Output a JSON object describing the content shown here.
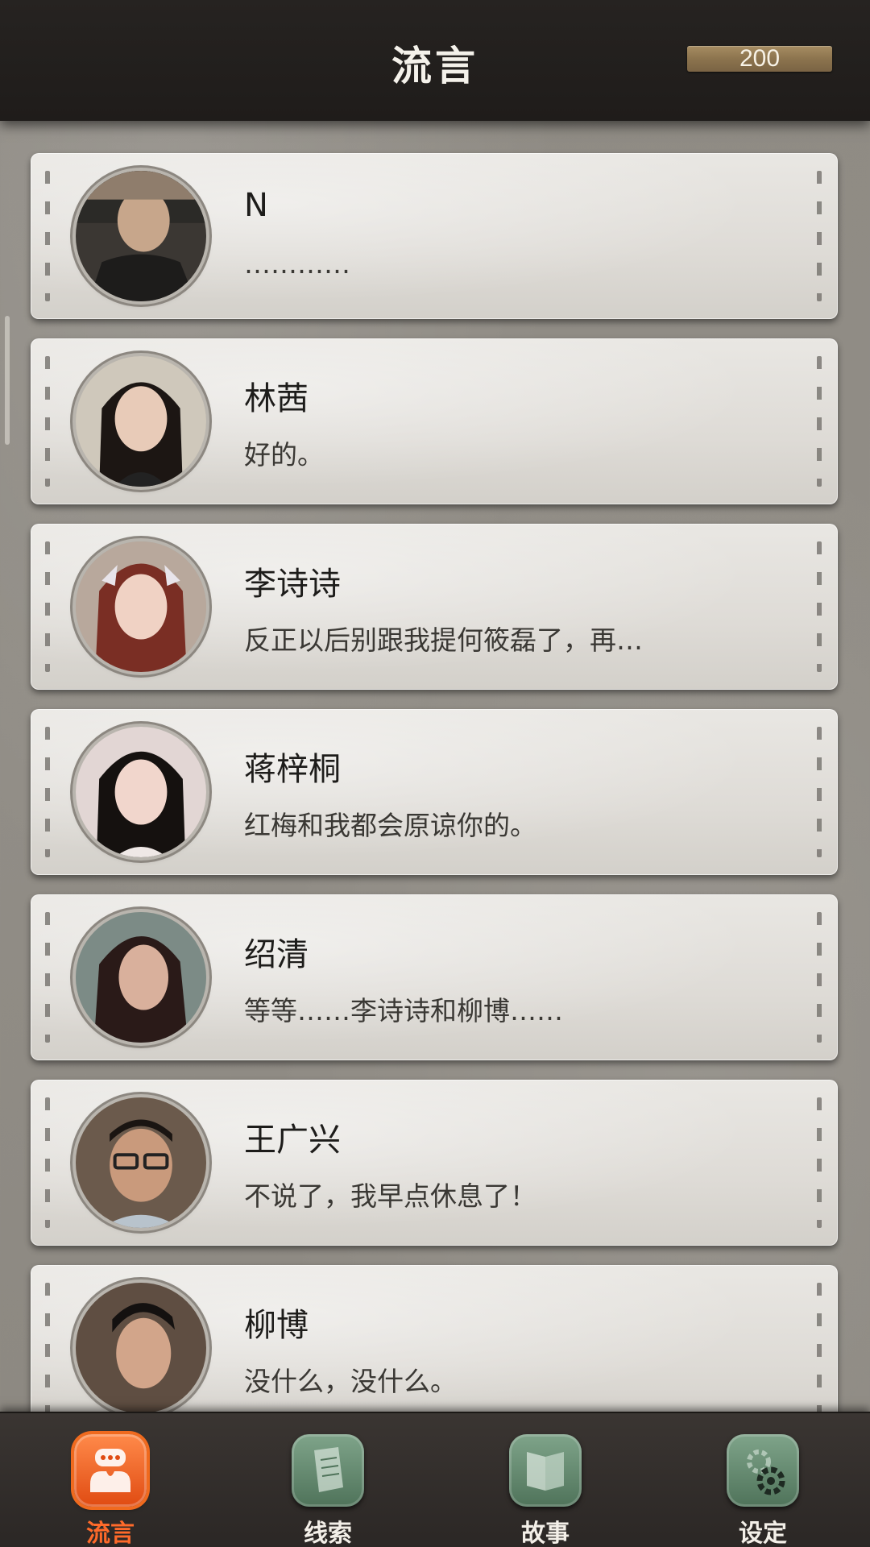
{
  "header": {
    "title": "流言",
    "coins": "200"
  },
  "contacts": [
    {
      "name": "N",
      "message": "…………",
      "avatar_color": "#4a4540"
    },
    {
      "name": "林茜",
      "message": "好的。",
      "avatar_color": "#c9b7a8"
    },
    {
      "name": "李诗诗",
      "message": "反正以后别跟我提何筱磊了，再…",
      "avatar_color": "#b56d5c"
    },
    {
      "name": "蒋梓桐",
      "message": "红梅和我都会原谅你的。",
      "avatar_color": "#d8c2bf"
    },
    {
      "name": "绍清",
      "message": "等等……李诗诗和柳博……",
      "avatar_color": "#a68878"
    },
    {
      "name": "王广兴",
      "message": "不说了，我早点休息了！",
      "avatar_color": "#7d6a58"
    },
    {
      "name": "柳博",
      "message": "没什么，没什么。",
      "avatar_color": "#6f5c4e"
    }
  ],
  "nav": [
    {
      "label": "流言",
      "icon": "chat-icon",
      "active": true
    },
    {
      "label": "线索",
      "icon": "document-icon",
      "active": false
    },
    {
      "label": "故事",
      "icon": "book-icon",
      "active": false
    },
    {
      "label": "设定",
      "icon": "gear-icon",
      "active": false
    }
  ],
  "colors": {
    "accent": "#ff6a2a",
    "nav_green": "#5f8a6c",
    "header_bg": "#221f1d",
    "card_bg": "#e4e2de"
  }
}
